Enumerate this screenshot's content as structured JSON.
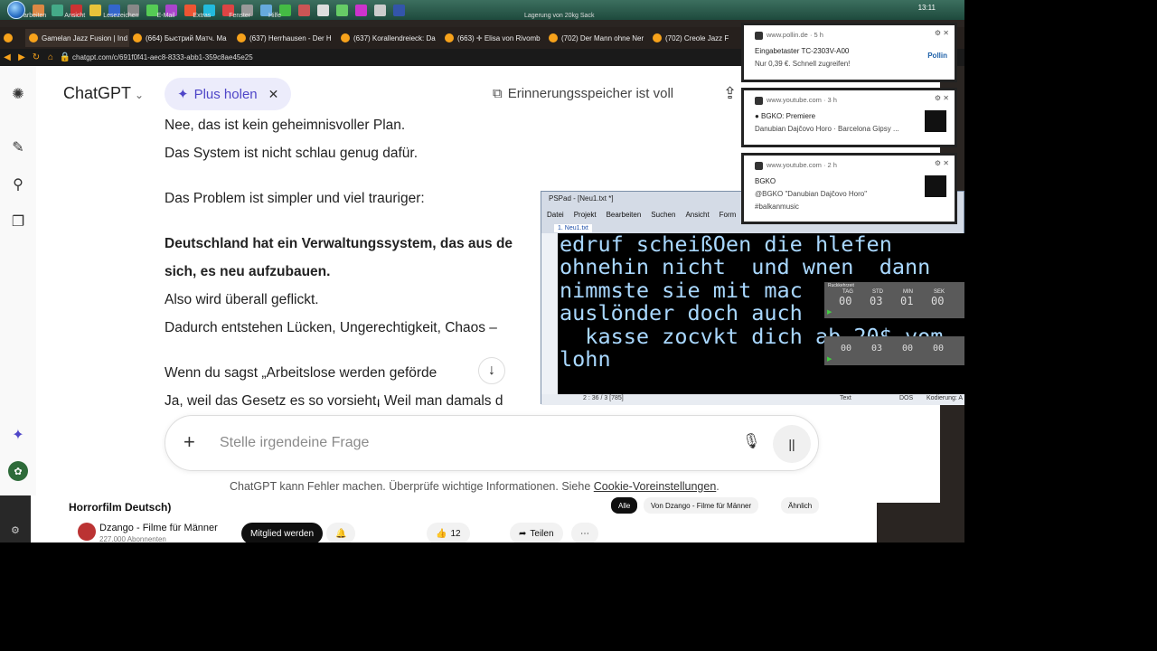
{
  "taskbar": {
    "menu": [
      "arbeiten",
      "Ansicht",
      "Lesezeichen",
      "E-Mail",
      "Extras",
      "Fenster",
      "Hilfe"
    ],
    "caption": "Lagerung von 20kg Sack",
    "clock": "13:11"
  },
  "tabs": [
    "Gamelan Jazz Fusion | Ind",
    "(664) Быстрий Матч. Ma",
    "(637) Herrhausen - Der H",
    "(637) Korallendreieck: Da",
    "(663) ✛ Elisa von Rivomb",
    "(702) Der Mann ohne Ner",
    "(702) Creole Jazz F"
  ],
  "address": "chatgpt.com/c/691f0f41-aec8-8333-abb1-359c8ae45e25",
  "header": {
    "brand": "ChatGPT",
    "plus_label": "Plus holen",
    "memory": "Erinnerungsspeicher ist voll"
  },
  "messages": [
    {
      "text": "Nee, das ist kein geheimnisvoller Plan.",
      "bold": false
    },
    {
      "text": "Das System ist nicht schlau genug dafür.",
      "bold": false
    },
    {
      "text": "",
      "bold": false
    },
    {
      "text": "Das Problem ist simpler und viel trauriger:",
      "bold": false
    },
    {
      "text": "",
      "bold": false
    },
    {
      "text": "Deutschland hat ein Verwaltungssystem, das aus de",
      "bold": true
    },
    {
      "text": "sich, es neu aufzubauen.",
      "bold": true
    },
    {
      "text": "Also wird überall geflickt.",
      "bold": false
    },
    {
      "text": "Dadurch entstehen Lücken, Ungerechtigkeit, Chaos –",
      "bold": false
    },
    {
      "text": "",
      "bold": false
    },
    {
      "text": "Wenn du sagst „Arbeitslose werden geförde",
      "bold": false
    },
    {
      "text": "Ja, weil das Gesetz es so vorsieht. Weil man damals d",
      "bold": false
    }
  ],
  "composer": {
    "placeholder": "Stelle irgendeine Frage"
  },
  "footer": {
    "text": "ChatGPT kann Fehler machen. Überprüfe wichtige Informationen. Siehe ",
    "link": "Cookie-Voreinstellungen",
    "end": "."
  },
  "youtube": {
    "title": "Horrorfilm Deutsch)",
    "channel": "Dzango - Filme für Männer",
    "subs": "227.000 Abonnenten",
    "join": "Mitglied werden",
    "likes": "12",
    "share": "Teilen",
    "chips": [
      "Alle",
      "Von Dzango - Filme für Männer",
      "Ähnlich"
    ]
  },
  "pspad": {
    "title": "PSPad - [Neu1.txt *]",
    "menu": [
      "Datei",
      "Projekt",
      "Bearbeiten",
      "Suchen",
      "Ansicht",
      "Form"
    ],
    "tab": "1. Neu1.txt",
    "lines": [
      "edruf scheißOen die hlefen",
      "ohnehin nicht  und wnen  dann",
      "nimmste sie mit mac",
      "auslönder doch auch",
      "  kasse zocvkt dich ab 20$ vom",
      "lohn"
    ],
    "status": {
      "pos": "2 : 36 / 3  [785]",
      "mode": "Text",
      "eol": "DOS",
      "enc": "Kodierung: A"
    }
  },
  "timer": {
    "title": "Ruckkehrzeit",
    "labels": [
      "TAG",
      "STD",
      "MIN",
      "SEK"
    ],
    "values": [
      "00",
      "03",
      "01",
      "00"
    ],
    "values2": [
      "00",
      "03",
      "00",
      "00"
    ]
  },
  "notifications": [
    {
      "source": "www.pollin.de · 5 h",
      "line1": "Eingabetaster TC-2303V-A00",
      "line2": "Nur 0,39 €. Schnell zugreifen!",
      "logo": "Pollin"
    },
    {
      "source": "www.youtube.com · 3 h",
      "line1": "● BGKO: Premiere",
      "line2": "Danubian Dajčovo Horo · Barcelona Gipsy ..."
    },
    {
      "source": "www.youtube.com · 2 h",
      "line1": "BGKO",
      "line2": "@BGKO \"Danubian Dajčovo Horo\"",
      "line3": "#balkanmusic"
    }
  ]
}
